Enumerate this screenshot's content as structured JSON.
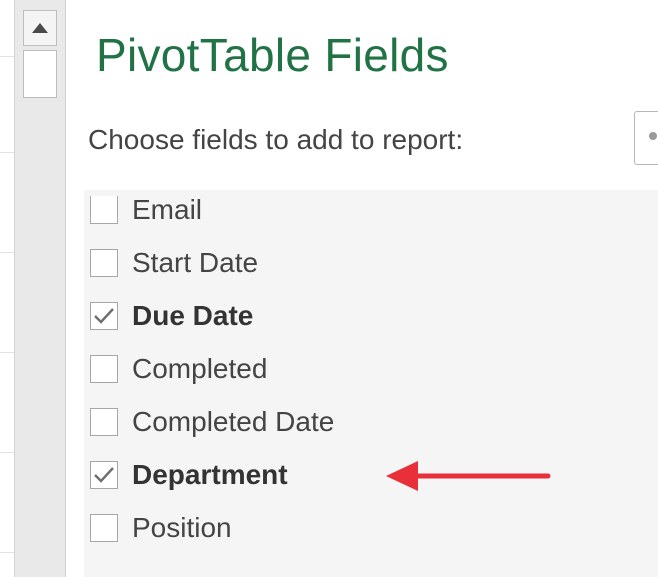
{
  "pane": {
    "title": "PivotTable Fields",
    "subtitle": "Choose fields to add to report:"
  },
  "fields": [
    {
      "label": "Email",
      "checked": false
    },
    {
      "label": "Start Date",
      "checked": false
    },
    {
      "label": "Due Date",
      "checked": true
    },
    {
      "label": "Completed",
      "checked": false
    },
    {
      "label": "Completed Date",
      "checked": false
    },
    {
      "label": "Department",
      "checked": true
    },
    {
      "label": "Position",
      "checked": false
    }
  ],
  "colors": {
    "title_green": "#217346",
    "annotation_arrow": "#e8303a",
    "checkmark": "#6e6e6e"
  },
  "icons": {
    "scroll_up": "triangle-up-icon",
    "checkmark": "checkmark-icon",
    "tools": "gear-icon",
    "annotation": "red-arrow-icon"
  }
}
